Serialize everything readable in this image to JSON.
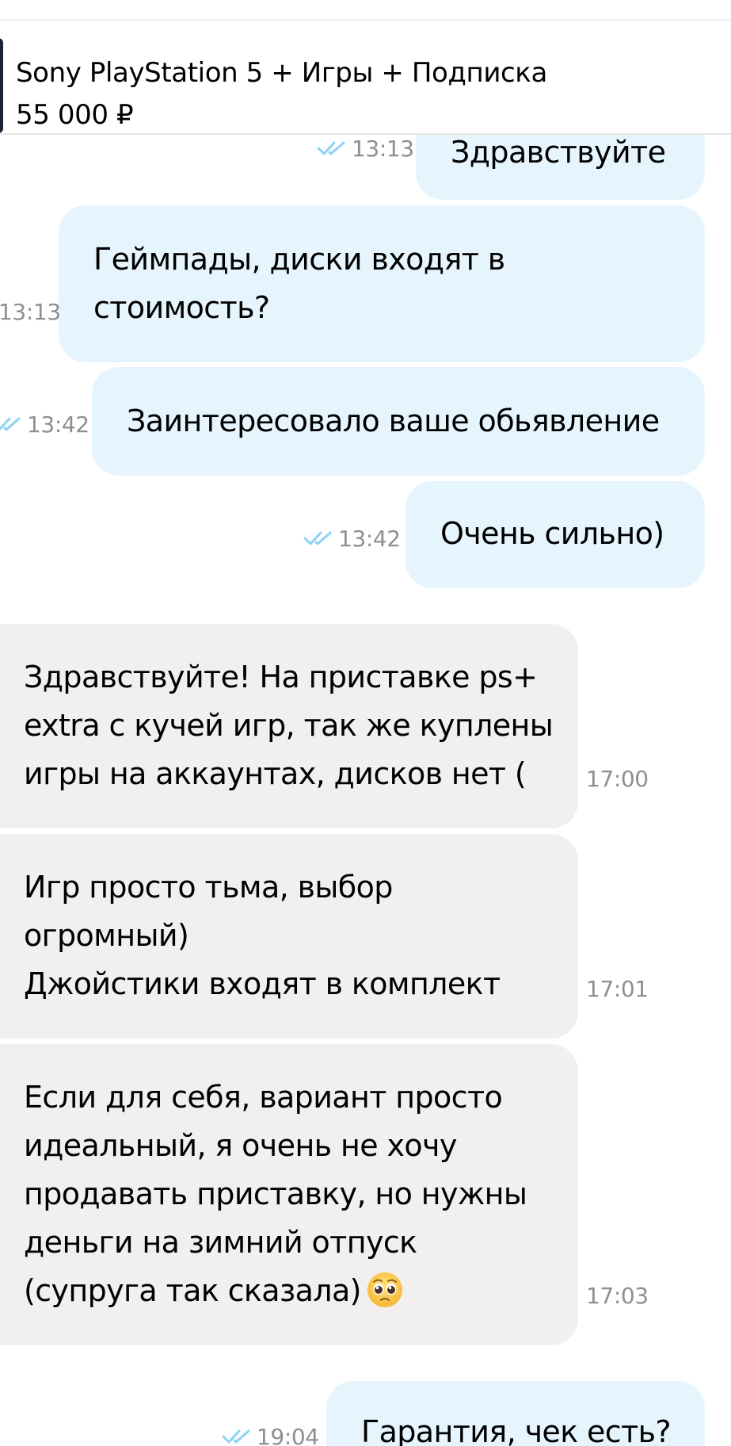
{
  "listing": {
    "title": "Sony PlayStation 5 + Игры + Подписка",
    "price": "55 000 ₽"
  },
  "messages": [
    {
      "direction": "outgoing",
      "lines": [
        "Здравствуйте"
      ],
      "time": "13:13",
      "read": true
    },
    {
      "direction": "outgoing",
      "lines": [
        "Геймпады, диски входят в",
        "стоимость?"
      ],
      "time": "13:13",
      "read": true
    },
    {
      "direction": "outgoing",
      "lines": [
        "Заинтересовало ваше обьявление"
      ],
      "time": "13:42",
      "read": true
    },
    {
      "direction": "outgoing",
      "lines": [
        "Очень сильно)"
      ],
      "time": "13:42",
      "read": true
    },
    {
      "direction": "incoming",
      "lines": [
        "Здравствуйте! На приставке ps+",
        "extra с кучей игр, так же куплены",
        "игры на аккаунтах, дисков нет ("
      ],
      "time": "17:00"
    },
    {
      "direction": "incoming",
      "lines": [
        "Игр просто тьма, выбор",
        "огромный)",
        "Джойстики входят в комплект"
      ],
      "time": "17:01"
    },
    {
      "direction": "incoming",
      "lines": [
        "Если для себя, вариант просто",
        "идеальный, я очень не хочу",
        "продавать приставку, но нужны",
        "деньги на зимний отпуск",
        "(супруга так сказала)"
      ],
      "emoji": "pleading-face",
      "time": "17:03"
    },
    {
      "direction": "outgoing",
      "lines": [
        "Гарантия, чек есть?"
      ],
      "time": "19:04",
      "read": true
    }
  ],
  "colors": {
    "outgoing_bubble": "#e6f5fd",
    "incoming_bubble": "#f1f0ee",
    "read_tick": "#8ad3f4",
    "timestamp": "#8f8f8f"
  }
}
